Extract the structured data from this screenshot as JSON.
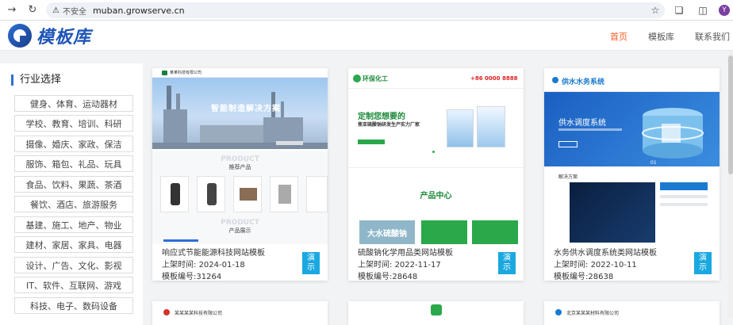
{
  "browser": {
    "back_icon": "arrow-right-icon",
    "insecure_label": "不安全",
    "url": "muban.growserve.cn",
    "avatar_letter": "Y"
  },
  "header": {
    "logo_text": "模板库",
    "nav": [
      {
        "label": "首页",
        "active": true
      },
      {
        "label": "模板库",
        "active": false
      },
      {
        "label": "联系我们",
        "active": false
      }
    ]
  },
  "sidebar": {
    "title": "行业选择",
    "categories": [
      "健身、体育、运动器材",
      "学校、教育、培训、科研",
      "摄像、婚庆、家政、保洁",
      "服饰、箱包、礼品、玩具",
      "食品、饮料、果蔬、茶酒",
      "餐饮、酒店、旅游服务",
      "基建、施工、地产、物业",
      "建材、家居、家具、电器",
      "设计、广告、文化、影视",
      "IT、软件、互联网、游戏",
      "科技、电子、数码设备"
    ]
  },
  "cards": [
    {
      "title": "响应式节能能源科技网站模板",
      "date_label": "上架时间:",
      "date": "2024-01-18",
      "id_label": "模板编号:",
      "id": "31264",
      "demo_label": "演示",
      "thumb": {
        "company": "某某科技有限公司",
        "hero_text": "智能制造解决方案",
        "section1": "PRODUCT",
        "section1_cn": "推荐产品",
        "section2": "PRODUCT",
        "section2_cn": "产品展示"
      }
    },
    {
      "title": "硫酸钠化学用品类网站模板",
      "date_label": "上架时间:",
      "date": "2022-11-17",
      "id_label": "模板编号:",
      "id": "28648",
      "demo_label": "演示",
      "thumb": {
        "brand": "环保化工",
        "phone": "+86 0000 8888",
        "hero_title": "定制您想要的",
        "hero_sub": "焦亚硫酸钠研发生产实力厂家",
        "section": "产品中心",
        "banner_text": "大水硫酸钠"
      }
    },
    {
      "title": "水务供水调度系统类网站模板",
      "date_label": "上架时间:",
      "date": "2022-10-11",
      "id_label": "模板编号:",
      "id": "28638",
      "demo_label": "演示",
      "thumb": {
        "brand": "供水水务系统",
        "hero_title": "供水调度系统",
        "pager": "01",
        "section": "解决方案"
      }
    }
  ],
  "bottom_cards": [
    {
      "company": "某某某某科技有限公司"
    },
    {
      "company": ""
    },
    {
      "company": "北京某某某材料有限公司"
    }
  ]
}
